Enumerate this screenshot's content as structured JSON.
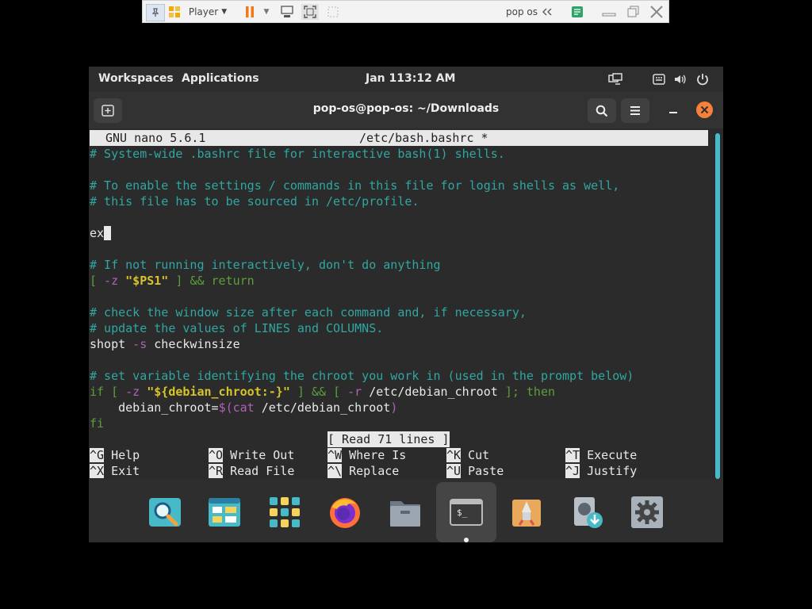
{
  "vm_toolbar": {
    "player_label": "Player",
    "vm_name": "pop os"
  },
  "topbar": {
    "workspaces": "Workspaces",
    "applications": "Applications",
    "date": "Jan 11",
    "time": "3:12 AM"
  },
  "terminal": {
    "title": "pop-os@pop-os: ~/Downloads"
  },
  "nano": {
    "version": "GNU nano 5.6.1",
    "filename": "/etc/bash.bashrc *",
    "status": "[ Read 71 lines ]",
    "lines": [
      "# System-wide .bashrc file for interactive bash(1) shells.",
      "",
      "# To enable the settings / commands in this file for login shells as well,",
      "# this file has to be sourced in /etc/profile.",
      "",
      "ex",
      "",
      "# If not running interactively, don't do anything",
      "[ -z \"$PS1\" ] && return",
      "",
      "# check the window size after each command and, if necessary,",
      "# update the values of LINES and COLUMNS.",
      "shopt -s checkwinsize",
      "",
      "# set variable identifying the chroot you work in (used in the prompt below)",
      "if [ -z \"${debian_chroot:-}\" ] && [ -r /etc/debian_chroot ]; then",
      "    debian_chroot=$(cat /etc/debian_chroot)",
      "fi"
    ],
    "shortcuts": [
      {
        "key": "^G",
        "label": "Help"
      },
      {
        "key": "^O",
        "label": "Write Out"
      },
      {
        "key": "^W",
        "label": "Where Is"
      },
      {
        "key": "^K",
        "label": "Cut"
      },
      {
        "key": "^T",
        "label": "Execute"
      },
      {
        "key": "^X",
        "label": "Exit"
      },
      {
        "key": "^R",
        "label": "Read File"
      },
      {
        "key": "^\\",
        "label": "Replace"
      },
      {
        "key": "^U",
        "label": "Paste"
      },
      {
        "key": "^J",
        "label": "Justify"
      }
    ]
  },
  "dock": {
    "terminal_glyph": "$_"
  }
}
